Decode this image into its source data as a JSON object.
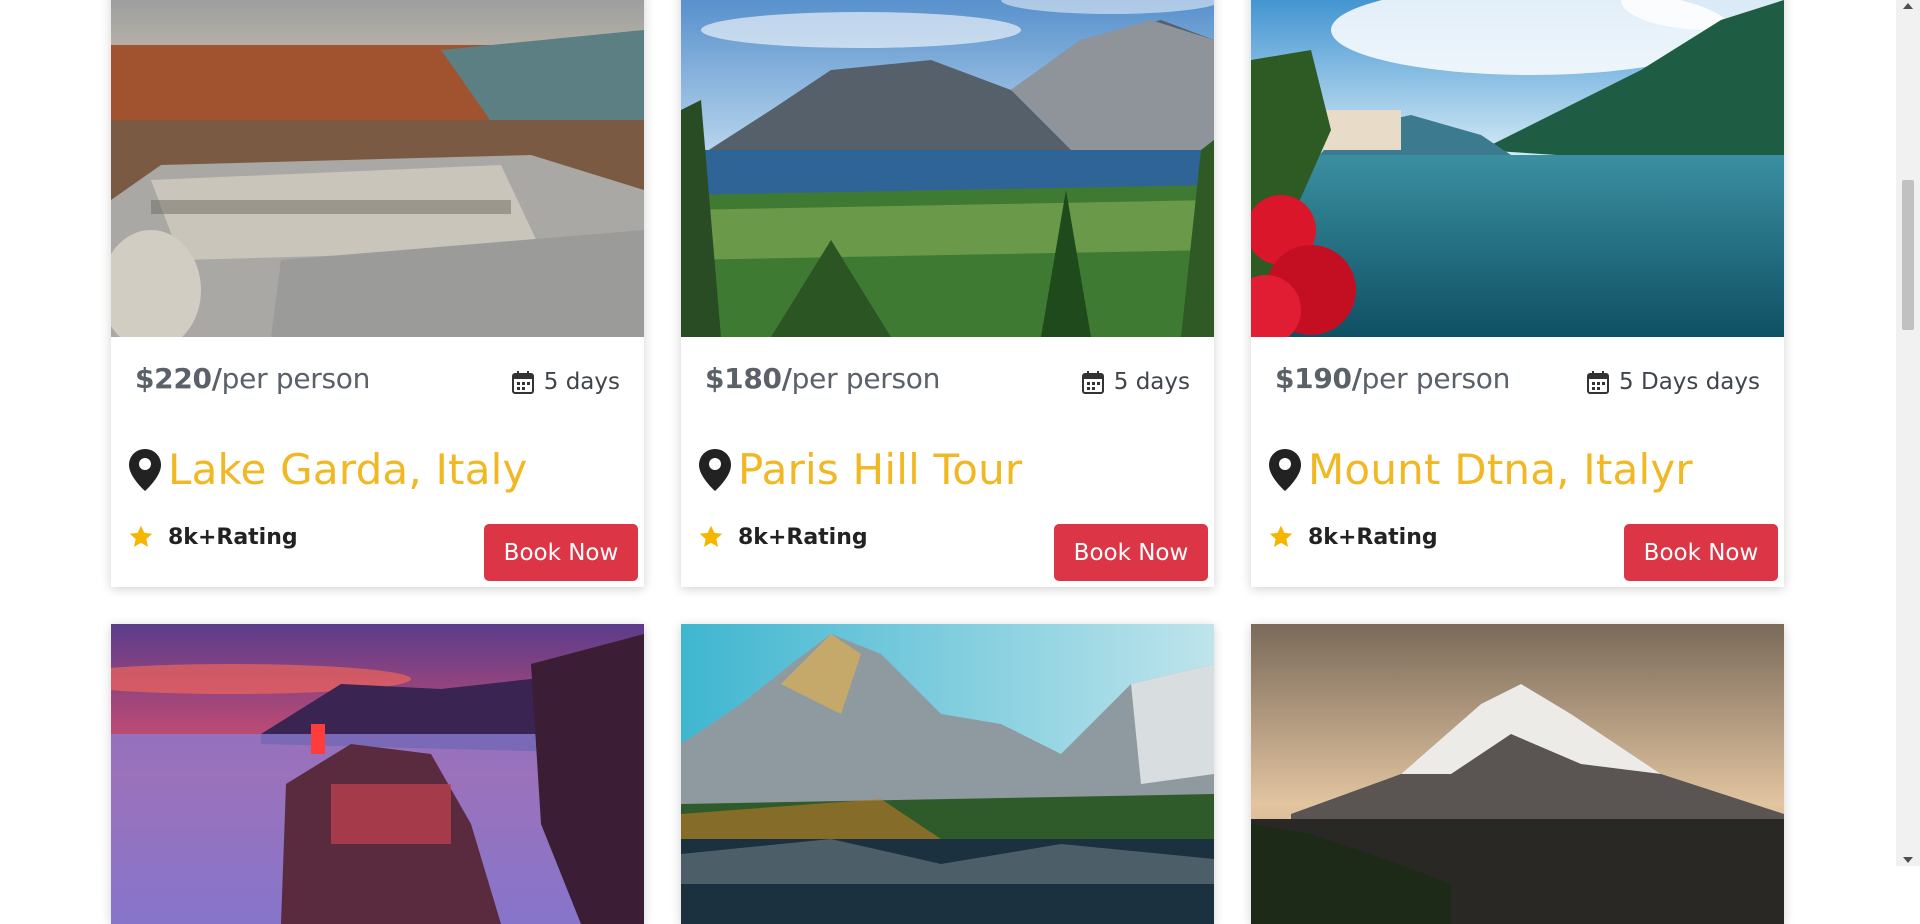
{
  "tours": [
    {
      "price": "$220/",
      "per": "per person",
      "duration": "5 days",
      "place": "Lake Garda, Italy",
      "rating": "8k+Rating",
      "book": "Book Now"
    },
    {
      "price": "$180/",
      "per": "per person",
      "duration": "5 days",
      "place": "Paris Hill Tour",
      "rating": "8k+Rating",
      "book": "Book Now"
    },
    {
      "price": "$190/",
      "per": "per person",
      "duration": "5 Days days",
      "place": "Mount Dtna, Italyr",
      "rating": "8k+Rating",
      "book": "Book Now"
    }
  ],
  "icons": {
    "calendar": "calendar-icon",
    "pin": "map-pin-icon",
    "star": "star-icon"
  },
  "colors": {
    "accent": "#f2b824",
    "button": "#dc3545",
    "price_text": "#5a6169",
    "star": "#f5b600"
  }
}
